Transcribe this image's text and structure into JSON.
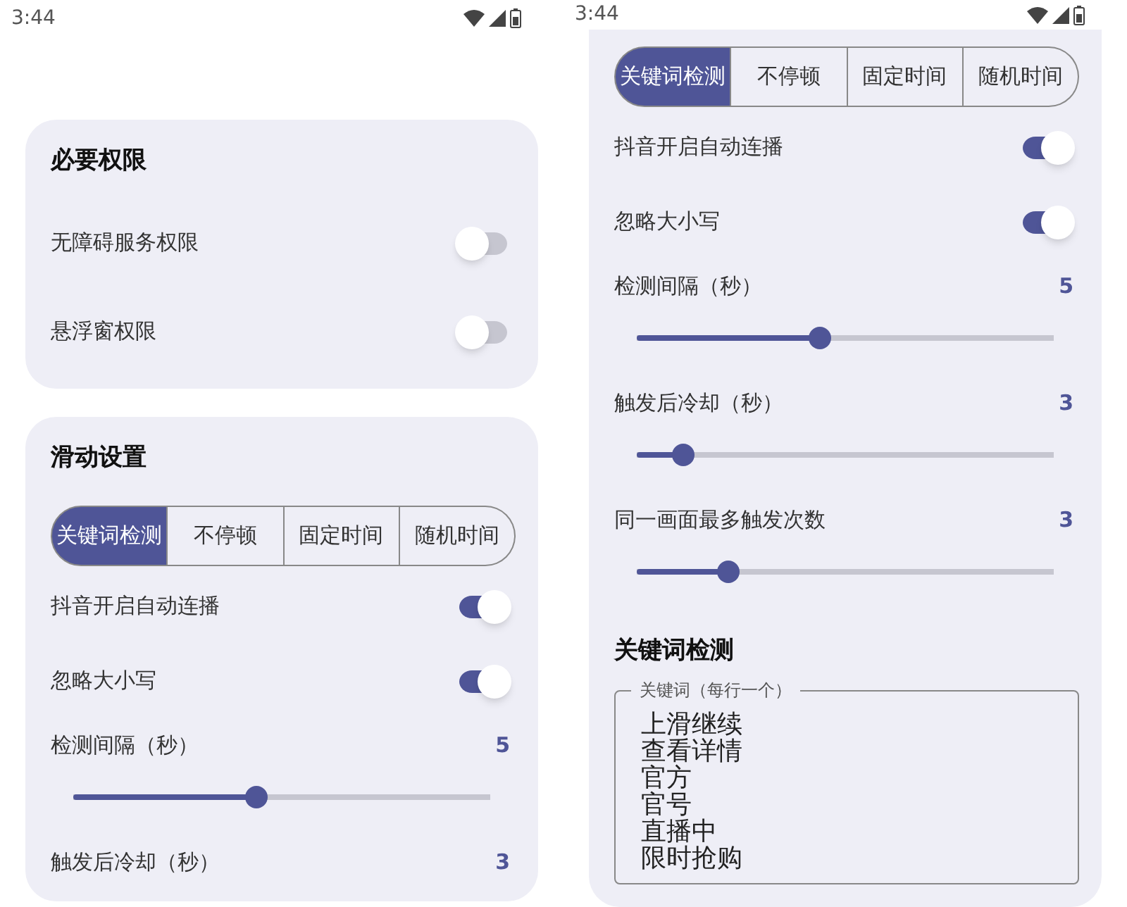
{
  "screens": [
    {
      "status_bar": {
        "time": "3:44"
      },
      "scrolled": false,
      "cards": [
        {
          "title": "必要权限",
          "items": [
            {
              "kind": "toggle",
              "label": "无障碍服务权限",
              "on": false
            },
            {
              "kind": "toggle",
              "label": "悬浮窗权限",
              "on": false
            }
          ]
        },
        {
          "title": "滑动设置",
          "items": [
            {
              "kind": "segmented",
              "options": [
                {
                  "label": "关键词检测",
                  "selected": true
                },
                {
                  "label": "不停顿",
                  "selected": false
                },
                {
                  "label": "固定时间",
                  "selected": false
                },
                {
                  "label": "随机时间",
                  "selected": false
                }
              ]
            },
            {
              "kind": "toggle",
              "label": "抖音开启自动连播",
              "on": true
            },
            {
              "kind": "toggle",
              "label": "忽略大小写",
              "on": true
            },
            {
              "kind": "slider",
              "label": "检测间隔（秒）",
              "value": "5",
              "level": 0.44
            },
            {
              "kind": "label",
              "label": "触发后冷却（秒）",
              "value": "3"
            }
          ]
        }
      ]
    },
    {
      "status_bar": {
        "time": "3:44"
      },
      "scrolled": true,
      "cards": [
        {
          "items": [
            {
              "kind": "segmented",
              "options": [
                {
                  "label": "关键词检测",
                  "selected": true
                },
                {
                  "label": "不停顿",
                  "selected": false
                },
                {
                  "label": "固定时间",
                  "selected": false
                },
                {
                  "label": "随机时间",
                  "selected": false
                }
              ]
            },
            {
              "kind": "toggle",
              "label": "抖音开启自动连播",
              "on": true
            },
            {
              "kind": "toggle",
              "label": "忽略大小写",
              "on": true
            },
            {
              "kind": "slider",
              "label": "检测间隔（秒）",
              "value": "5",
              "level": 0.44
            },
            {
              "kind": "slider",
              "label": "触发后冷却（秒）",
              "value": "3",
              "level": 0.11
            },
            {
              "kind": "slider",
              "label": "同一画面最多触发次数",
              "value": "3",
              "level": 0.22
            },
            {
              "kind": "heading",
              "label": "关键词检测"
            },
            {
              "kind": "textarea",
              "label": "关键词（每行一个）",
              "lines": [
                "上滑继续",
                "查看详情",
                "官方",
                "官号",
                "直播中",
                "限时抢购"
              ]
            }
          ]
        }
      ]
    }
  ]
}
